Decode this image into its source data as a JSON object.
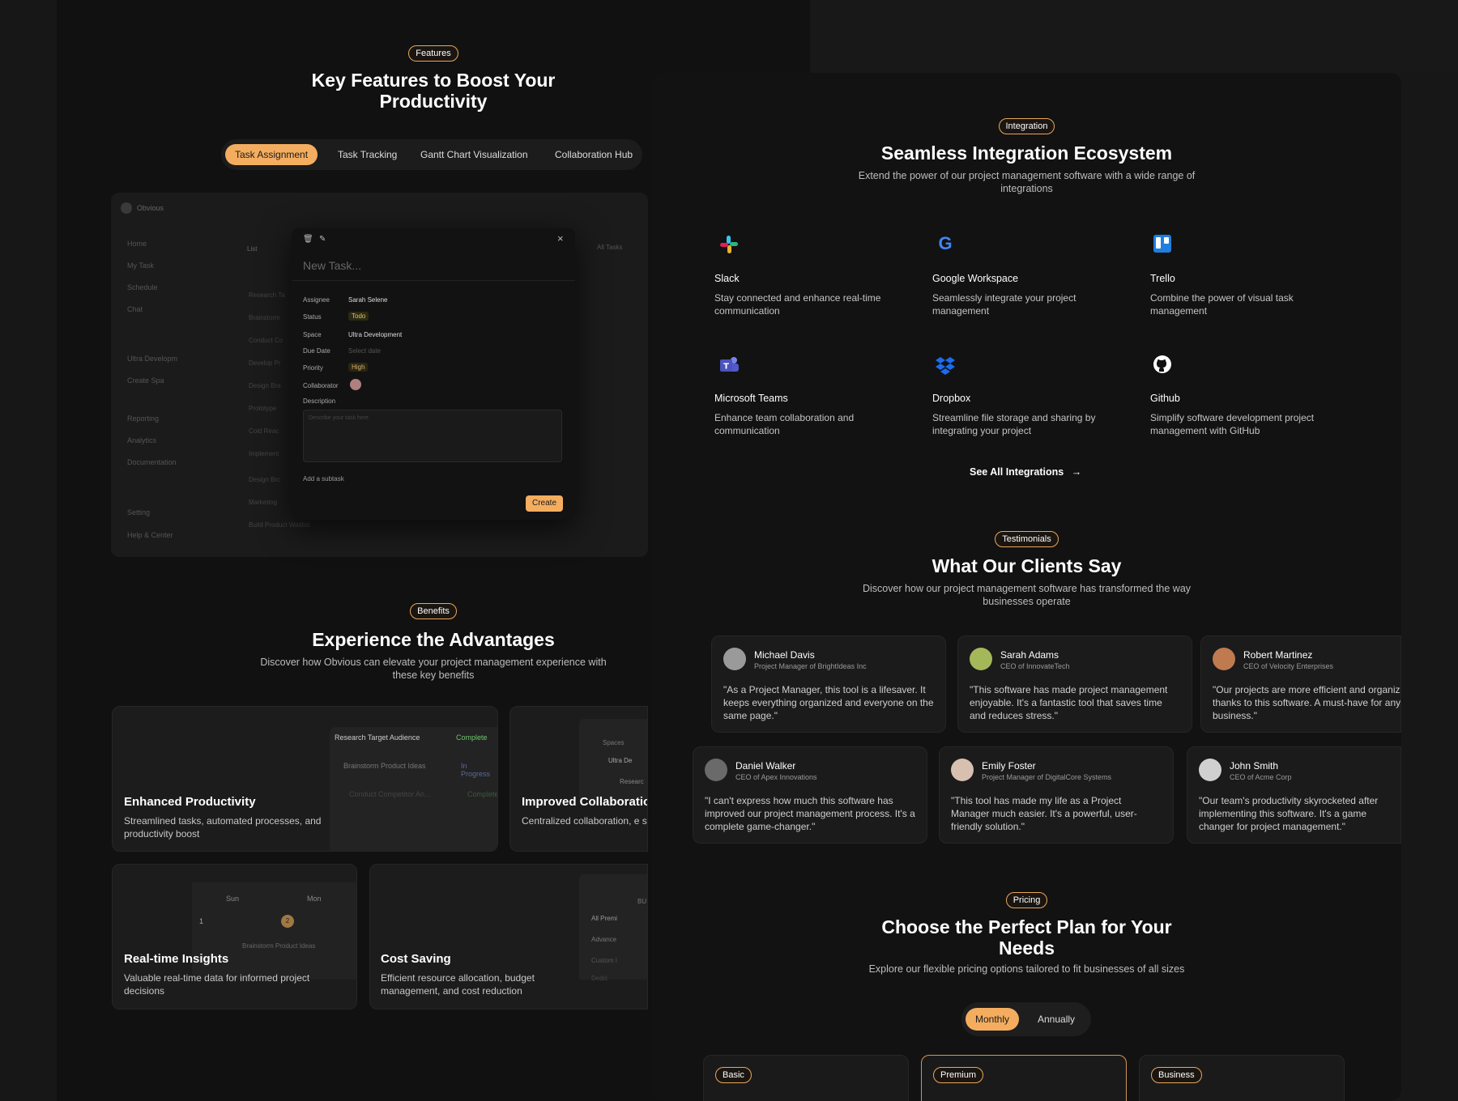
{
  "features": {
    "badge": "Features",
    "title": "Key Features to Boost Your Productivity",
    "tabs": [
      "Task Assignment",
      "Task Tracking",
      "Gantt Chart Visualization",
      "Collaboration Hub"
    ],
    "app": {
      "brand": "Obvious",
      "sidebar": [
        "Home",
        "My Task",
        "Schedule",
        "Chat",
        "Ultra Developm",
        "Create Spa",
        "Reporting",
        "Analytics",
        "Documentation",
        "Setting",
        "Help & Center"
      ],
      "list_tab": "List",
      "filter": "All Tasks",
      "rows": [
        "Research Ta",
        "Brainstorm",
        "Conduct Co",
        "Develop Pr",
        "Design Bra",
        "Prototype",
        "Cold Reac",
        "Implement",
        "Design Brc",
        "Marketing",
        "Build Product Waitlist"
      ],
      "modal": {
        "placeholder": "New Task...",
        "fields": [
          {
            "label": "Assignee",
            "value": "Sarah Selene"
          },
          {
            "label": "Status",
            "value": "Todo"
          },
          {
            "label": "Space",
            "value": "Ultra Development"
          },
          {
            "label": "Due Date",
            "value": "Select date"
          },
          {
            "label": "Priority",
            "value": "High"
          },
          {
            "label": "Collaborator",
            "value": ""
          },
          {
            "label": "Description",
            "value": ""
          }
        ],
        "desc_placeholder": "Describe your task here",
        "add_subtask": "Add a subtask",
        "create": "Create"
      }
    }
  },
  "benefits": {
    "badge": "Benefits",
    "title": "Experience the Advantages",
    "subtitle": "Discover how Obvious can elevate your project management experience with these key benefits",
    "cards": [
      {
        "title": "Enhanced Productivity",
        "desc": "Streamlined tasks, automated processes, and productivity boost",
        "mock": [
          {
            "task": "Research Target Audience",
            "status": "Complete"
          },
          {
            "task": "Brainstorm Product Ideas",
            "status": "In Progress"
          },
          {
            "task": "Conduct Competitor An...",
            "status": "Complete"
          }
        ]
      },
      {
        "title": "Improved Collaboration",
        "desc": "Centralized collaboration, e stakeholder engagement",
        "mock": [
          "Spaces",
          "Ultra De",
          "Researc"
        ]
      },
      {
        "title": "Real-time Insights",
        "desc": "Valuable real-time data for informed project decisions",
        "mock": [
          "Sun",
          "Mon",
          "1",
          "2",
          "Brainstorm Product Ideas"
        ]
      },
      {
        "title": "Cost Saving",
        "desc": "Efficient resource allocation, budget management, and cost reduction",
        "mock": [
          "BU",
          "All Premi",
          "Advance",
          "Custom I",
          "Dedic"
        ]
      }
    ]
  },
  "integration": {
    "badge": "Integration",
    "title": "Seamless Integration Ecosystem",
    "subtitle": "Extend the power of our project management software with a wide range of integrations",
    "items": [
      {
        "name": "Slack",
        "desc": "Stay connected and enhance real-time communication",
        "icon": "slack-icon"
      },
      {
        "name": "Google Workspace",
        "desc": "Seamlessly integrate your project management",
        "icon": "google-icon"
      },
      {
        "name": "Trello",
        "desc": "Combine the power of visual task management",
        "icon": "trello-icon"
      },
      {
        "name": "Microsoft Teams",
        "desc": "Enhance team collaboration and communication",
        "icon": "teams-icon"
      },
      {
        "name": "Dropbox",
        "desc": "Streamline file storage and sharing by integrating your project",
        "icon": "dropbox-icon"
      },
      {
        "name": "Github",
        "desc": "Simplify software development project management with GitHub",
        "icon": "github-icon"
      }
    ],
    "see_all": "See All Integrations"
  },
  "testimonials": {
    "badge": "Testimonials",
    "title": "What Our Clients Say",
    "subtitle": "Discover how our project management software has transformed the way businesses operate",
    "row1": [
      {
        "name": "Michael Davis",
        "role": "Project Manager of BrightIdeas Inc",
        "quote": "\"As a Project Manager, this tool is a lifesaver. It keeps everything organized and everyone on the same page.\""
      },
      {
        "name": "Sarah Adams",
        "role": "CEO of InnovateTech",
        "quote": "\"This software has made project management enjoyable. It's a fantastic tool that saves time and reduces stress.\""
      },
      {
        "name": "Robert Martinez",
        "role": "CEO of Velocity Enterprises",
        "quote": "\"Our projects are more efficient and organized thanks to this software. A must-have for any business.\""
      }
    ],
    "row2": [
      {
        "name": "Daniel Walker",
        "role": "CEO of Apex Innovations",
        "quote": "\"I can't express how much this software has improved our project management process. It's a complete game-changer.\""
      },
      {
        "name": "Emily Foster",
        "role": "Project Manager of DigitalCore Systems",
        "quote": "\"This tool has made my life as a Project Manager much easier. It's a powerful, user-friendly solution.\""
      },
      {
        "name": "John Smith",
        "role": "CEO of Acme Corp",
        "quote": "\"Our team's productivity skyrocketed after implementing this software. It's a game changer for project management.\""
      }
    ]
  },
  "pricing": {
    "badge": "Pricing",
    "title": "Choose the Perfect Plan for Your Needs",
    "subtitle": "Explore our flexible pricing options tailored to fit businesses of all sizes",
    "toggle": [
      "Monthly",
      "Annually"
    ],
    "plans": [
      "Basic",
      "Premium",
      "Business"
    ]
  },
  "colors": {
    "accent": "#f4ad5f",
    "badge_border": "#e9a75c",
    "bg": "#121212"
  }
}
